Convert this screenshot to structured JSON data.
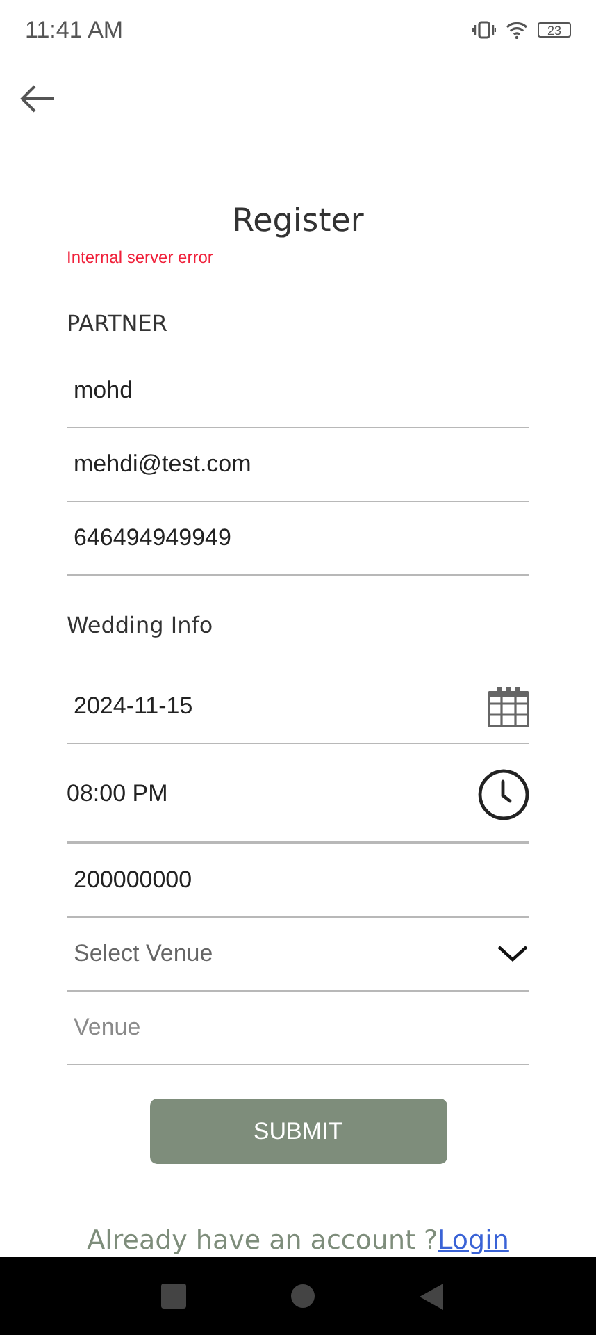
{
  "status_bar": {
    "time": "11:41 AM",
    "battery": "23"
  },
  "title": "Register",
  "error": "Internal server error",
  "partner": {
    "heading": "PARTNER",
    "fields": [
      {
        "kind": "text",
        "value": "mohd"
      },
      {
        "kind": "text",
        "value": "mehdi@test.com"
      },
      {
        "kind": "text",
        "value": "646494949949"
      }
    ]
  },
  "wedding": {
    "heading": "Wedding Info",
    "fields": [
      {
        "kind": "date",
        "value": "2024-11-15"
      },
      {
        "kind": "time",
        "value": "08:00 PM"
      },
      {
        "kind": "text",
        "value": "200000000"
      },
      {
        "kind": "select",
        "placeholder": "Select Venue"
      },
      {
        "kind": "text",
        "placeholder": "Venue"
      }
    ]
  },
  "submit": "SUBMIT",
  "footer": {
    "text": "Already have an account ?",
    "link": "Login"
  }
}
